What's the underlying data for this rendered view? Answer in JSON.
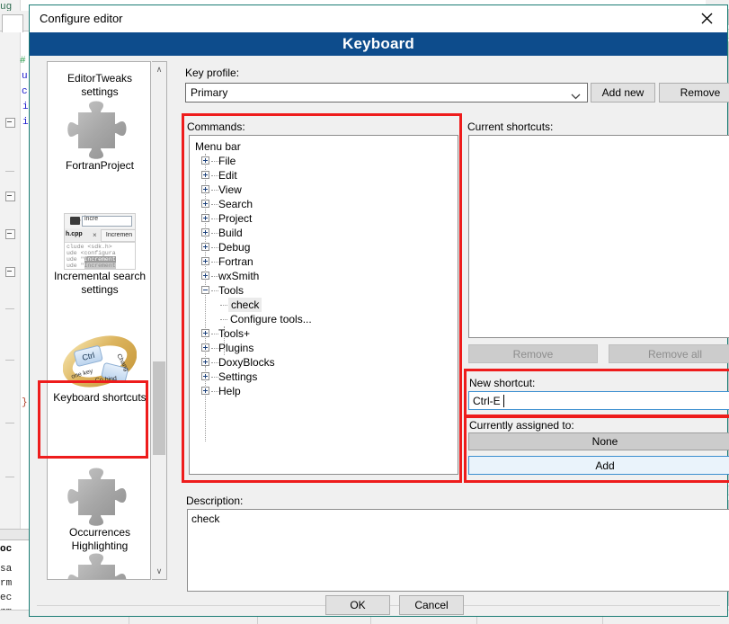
{
  "window": {
    "title": "Configure editor",
    "close_icon": "close-icon",
    "banner_title": "Keyboard"
  },
  "sidebar": {
    "scroll_up_glyph": "∧",
    "scroll_down_glyph": "∨",
    "items": [
      {
        "label": "EditorTweaks settings",
        "icon": "puzzle-piece-icon"
      },
      {
        "label": "FortranProject",
        "icon": "puzzle-piece-icon"
      },
      {
        "label": "Incremental search settings",
        "icon": "incremental-search-thumbnail-icon"
      },
      {
        "label": "Keyboard shortcuts",
        "icon": "keyboard-shortcuts-icon"
      },
      {
        "label": "Occurrences Highlighting",
        "icon": "puzzle-piece-icon"
      }
    ],
    "incremental_thumb": {
      "search_value": "incre",
      "tab_active": "h.cpp",
      "tab_close": "×",
      "tab_inactive": "Incremen",
      "code_lines": [
        "clude <sdk.h>  ",
        "ude <configura",
        "ude \"Increment",
        "ude \"Increment"
      ]
    },
    "keyboard_icon": {
      "key_label": "Ctrl",
      "ribbon_text": "one key Co bind Chang"
    }
  },
  "main": {
    "key_profile": {
      "label": "Key profile:",
      "value": "Primary",
      "add_new_label": "Add new",
      "remove_label": "Remove"
    },
    "commands": {
      "label": "Commands:",
      "root": "Menu bar",
      "nodes": [
        {
          "label": "File",
          "level": 1,
          "expandable": true,
          "expanded": false
        },
        {
          "label": "Edit",
          "level": 1,
          "expandable": true,
          "expanded": false
        },
        {
          "label": "View",
          "level": 1,
          "expandable": true,
          "expanded": false
        },
        {
          "label": "Search",
          "level": 1,
          "expandable": true,
          "expanded": false
        },
        {
          "label": "Project",
          "level": 1,
          "expandable": true,
          "expanded": false
        },
        {
          "label": "Build",
          "level": 1,
          "expandable": true,
          "expanded": false
        },
        {
          "label": "Debug",
          "level": 1,
          "expandable": true,
          "expanded": false
        },
        {
          "label": "Fortran",
          "level": 1,
          "expandable": true,
          "expanded": false
        },
        {
          "label": "wxSmith",
          "level": 1,
          "expandable": true,
          "expanded": false
        },
        {
          "label": "Tools",
          "level": 1,
          "expandable": true,
          "expanded": true
        },
        {
          "label": "check",
          "level": 2,
          "expandable": false,
          "selected": true
        },
        {
          "label": "Configure tools...",
          "level": 2,
          "expandable": false
        },
        {
          "label": "Tools+",
          "level": 1,
          "expandable": true,
          "expanded": false
        },
        {
          "label": "Plugins",
          "level": 1,
          "expandable": true,
          "expanded": false
        },
        {
          "label": "DoxyBlocks",
          "level": 1,
          "expandable": true,
          "expanded": false
        },
        {
          "label": "Settings",
          "level": 1,
          "expandable": true,
          "expanded": false
        },
        {
          "label": "Help",
          "level": 1,
          "expandable": true,
          "expanded": false
        }
      ]
    },
    "current_shortcuts": {
      "label": "Current shortcuts:",
      "items": [],
      "remove_label": "Remove",
      "remove_all_label": "Remove all"
    },
    "new_shortcut": {
      "label": "New shortcut:",
      "value": "Ctrl-E"
    },
    "currently_assigned": {
      "label": "Currently assigned to:",
      "value": "None",
      "add_label": "Add"
    },
    "description": {
      "label": "Description:",
      "value": "check"
    }
  },
  "footer": {
    "ok_label": "OK",
    "cancel_label": "Cancel"
  },
  "background": {
    "code_tokens": [
      "#",
      "u",
      "c",
      "i",
      "i"
    ],
    "brace": "}",
    "log_words": [
      "oc",
      "sa",
      "rm",
      "ec",
      "rm"
    ],
    "top_word": "ug"
  },
  "colors": {
    "banner": "#0d4c8c",
    "highlight_red": "#ee1c1c",
    "dialog_border": "#1b7d75",
    "accent_blue": "#3c8fd0"
  }
}
